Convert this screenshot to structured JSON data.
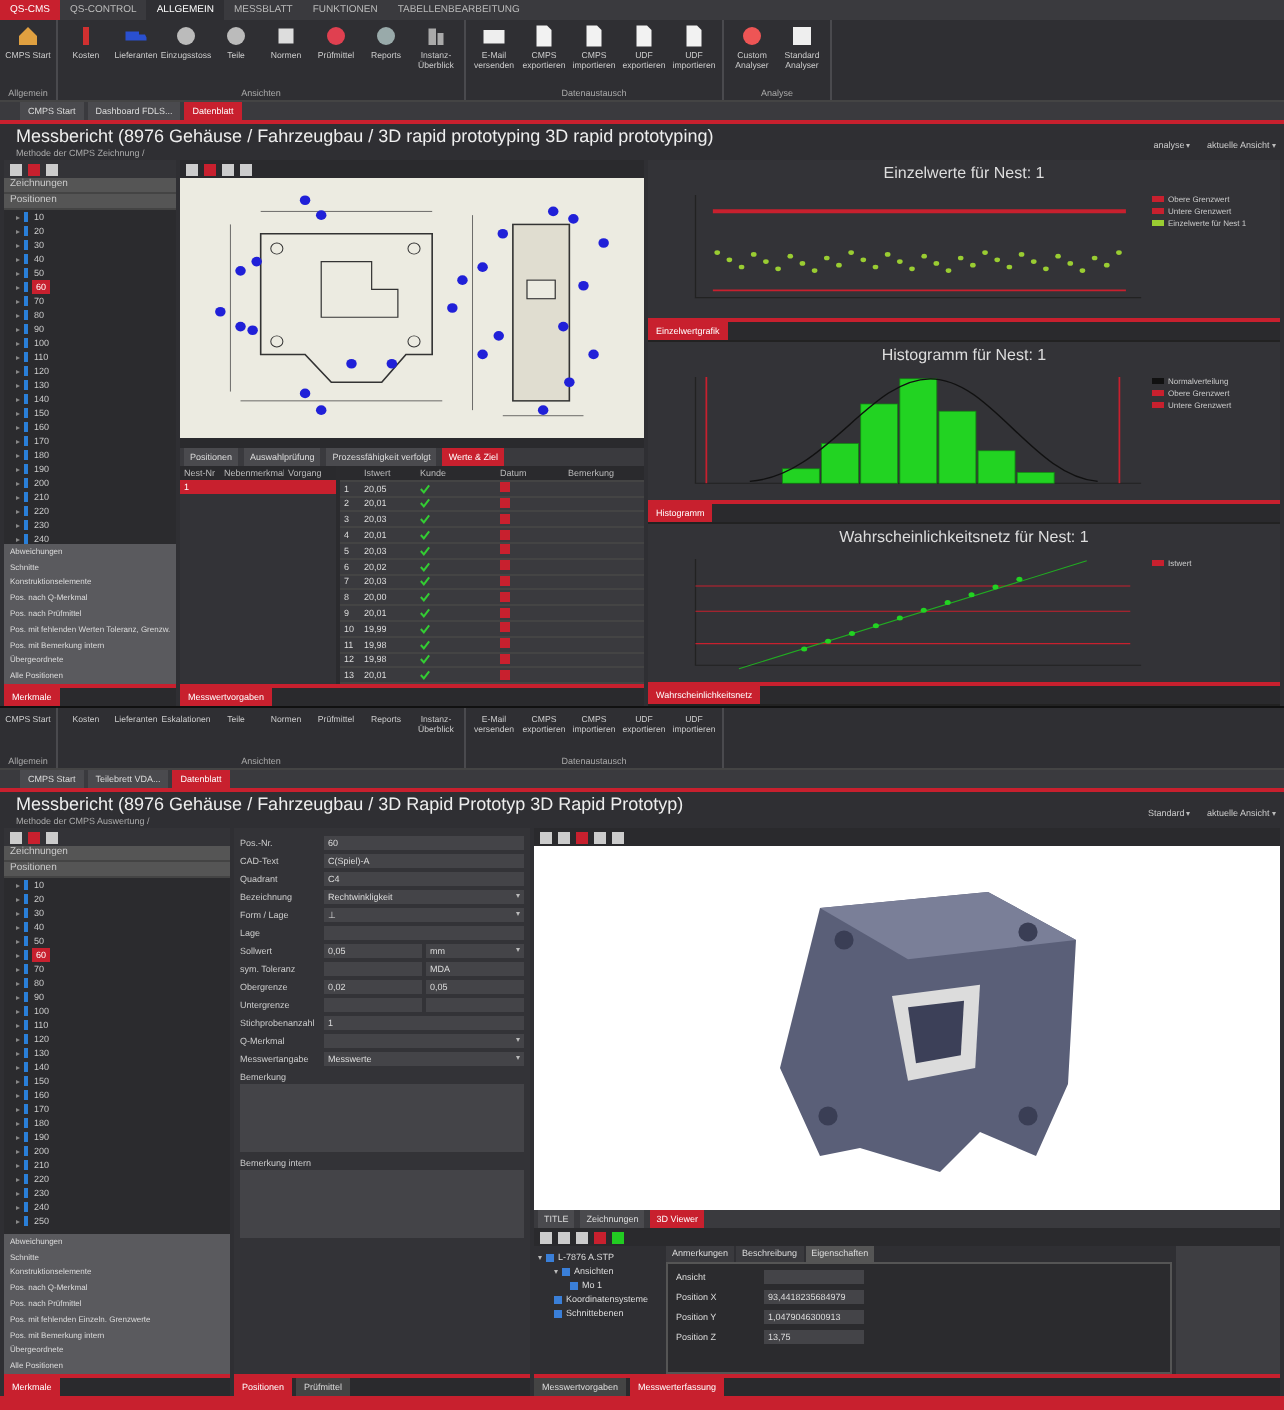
{
  "top": {
    "ribbon_tabs": [
      {
        "label": "QS-CMS",
        "selected": false
      },
      {
        "label": "QS-CONTROL",
        "selected": false
      },
      {
        "label": "ALLGEMEIN",
        "selected": true
      },
      {
        "label": "MESSBLATT",
        "selected": false
      },
      {
        "label": "FUNKTIONEN",
        "selected": false
      },
      {
        "label": "TABELLENBEARBEITUNG",
        "selected": false
      }
    ],
    "ribbon_groups": [
      {
        "label": "Allgemein",
        "buttons": [
          "CMPS Start"
        ]
      },
      {
        "label": "Ansichten",
        "buttons": [
          "Kosten",
          "Lieferanten",
          "Einzugsstoss",
          "Teile",
          "Normen",
          "Prüfmittel",
          "Reports",
          "Instanz-Überblick"
        ]
      },
      {
        "label": "Datenaustausch",
        "buttons": [
          "E-Mail versenden",
          "CMPS exportieren",
          "CMPS importieren",
          "UDF exportieren",
          "UDF importieren"
        ]
      },
      {
        "label": "Analyse",
        "buttons": [
          "Custom Analyser",
          "Standard Analyser"
        ]
      }
    ],
    "doc_tabs": [
      {
        "label": "CMPS Start",
        "selected": false
      },
      {
        "label": "Dashboard FDLS...",
        "selected": false
      },
      {
        "label": "Datenblatt",
        "selected": true
      }
    ],
    "title": "Messbericht (8976 Gehäuse / Fahrzeugbau / 3D rapid prototyping 3D rapid prototyping)",
    "subtitle": "Methode der CMPS Zeichnung /",
    "view_menus": [
      "analyse",
      "aktuelle Ansicht"
    ],
    "tree_headers": [
      "Zeichnungen",
      "Positionen"
    ],
    "tree_items": [
      {
        "label": "10",
        "selected": false
      },
      {
        "label": "20",
        "selected": false
      },
      {
        "label": "30",
        "selected": false
      },
      {
        "label": "40",
        "selected": false
      },
      {
        "label": "50",
        "selected": false
      },
      {
        "label": "60",
        "selected": true
      },
      {
        "label": "70",
        "selected": false
      },
      {
        "label": "80",
        "selected": false
      },
      {
        "label": "90",
        "selected": false
      },
      {
        "label": "100",
        "selected": false
      },
      {
        "label": "110",
        "selected": false
      },
      {
        "label": "120",
        "selected": false
      },
      {
        "label": "130",
        "selected": false
      },
      {
        "label": "140",
        "selected": false
      },
      {
        "label": "150",
        "selected": false
      },
      {
        "label": "160",
        "selected": false
      },
      {
        "label": "170",
        "selected": false
      },
      {
        "label": "180",
        "selected": false
      },
      {
        "label": "190",
        "selected": false
      },
      {
        "label": "200",
        "selected": false
      },
      {
        "label": "210",
        "selected": false
      },
      {
        "label": "220",
        "selected": false
      },
      {
        "label": "230",
        "selected": false
      },
      {
        "label": "240",
        "selected": false
      }
    ],
    "sections": [
      "Abweichungen",
      "Schnitte",
      "Konstruktionselemente",
      "Pos. nach Q-Merkmal",
      "Pos. nach Prüfmittel",
      "Pos. mit fehlenden Werten Toleranz, Grenzw.",
      "Pos. mit Bemerkung intern",
      "Übergeordnete",
      "Alle Positionen"
    ],
    "left_tab": "Merkmale",
    "drawing_tabs": [
      {
        "label": "Positionen",
        "selected": false
      },
      {
        "label": "Auswahlprüfung",
        "selected": false
      },
      {
        "label": "Prozessfähigkeit verfolgt",
        "selected": false
      },
      {
        "label": "Werte & Ziel",
        "selected": true
      }
    ],
    "nest_columns": [
      "Nest-Nr",
      "Nebenmerkmal",
      "Vorgang"
    ],
    "nest_rows": [
      {
        "cells": [
          "1",
          "",
          ""
        ],
        "selected": true
      }
    ],
    "value_columns": [
      "",
      "Istwert",
      "Kunde",
      "Datum",
      "Bemerkung"
    ],
    "value_rows": [
      {
        "index": "1",
        "value": "20,05",
        "passed": true,
        "flagged": true
      },
      {
        "index": "2",
        "value": "20,01",
        "passed": true,
        "flagged": true
      },
      {
        "index": "3",
        "value": "20,03",
        "passed": true,
        "flagged": true
      },
      {
        "index": "4",
        "value": "20,01",
        "passed": true,
        "flagged": true
      },
      {
        "index": "5",
        "value": "20,03",
        "passed": true,
        "flagged": true
      },
      {
        "index": "6",
        "value": "20,02",
        "passed": true,
        "flagged": true
      },
      {
        "index": "7",
        "value": "20,03",
        "passed": true,
        "flagged": true
      },
      {
        "index": "8",
        "value": "20,00",
        "passed": true,
        "flagged": true
      },
      {
        "index": "9",
        "value": "20,01",
        "passed": true,
        "flagged": true
      },
      {
        "index": "10",
        "value": "19,99",
        "passed": true,
        "flagged": true
      },
      {
        "index": "11",
        "value": "19,98",
        "passed": true,
        "flagged": true
      },
      {
        "index": "12",
        "value": "19,98",
        "passed": true,
        "flagged": true
      },
      {
        "index": "13",
        "value": "20,01",
        "passed": true,
        "flagged": true
      }
    ],
    "table_tab": "Messwertvorgaben",
    "charts": [
      {
        "kind": "scatter",
        "title": "Einzelwerte für Nest: 1",
        "tab": "Einzelwertgrafik",
        "legend": [
          {
            "label": "Obere Grenzwert",
            "color": "#c8202e"
          },
          {
            "label": "Untere Grenzwert",
            "color": "#c8202e"
          },
          {
            "label": "Einzelwerte für Nest 1",
            "color": "#9acd32"
          }
        ]
      },
      {
        "kind": "histogram",
        "title": "Histogramm für Nest: 1",
        "tab": "Histogramm",
        "legend": [
          {
            "label": "Normalverteilung",
            "color": "#111111"
          },
          {
            "label": "Obere Grenzwert",
            "color": "#c8202e"
          },
          {
            "label": "Untere Grenzwert",
            "color": "#c8202e"
          }
        ]
      },
      {
        "kind": "probability",
        "title": "Wahrscheinlichkeitsnetz für Nest: 1",
        "tab": "Wahrscheinlichkeitsnetz",
        "legend": [
          {
            "label": "Istwert",
            "color": "#c8202e"
          }
        ]
      }
    ]
  },
  "bottom": {
    "ribbon_groups": [
      {
        "label": "Allgemein",
        "buttons": [
          "CMPS Start"
        ]
      },
      {
        "label": "Ansichten",
        "buttons": [
          "Kosten",
          "Lieferanten",
          "Eskalationen",
          "Teile",
          "Normen",
          "Prüfmittel",
          "Reports",
          "Instanz-Überblick"
        ]
      },
      {
        "label": "Datenaustausch",
        "buttons": [
          "E-Mail versenden",
          "CMPS exportieren",
          "CMPS importieren",
          "UDF exportieren",
          "UDF importieren"
        ]
      }
    ],
    "doc_tabs": [
      {
        "label": "CMPS Start",
        "selected": false
      },
      {
        "label": "Teilebrett VDA...",
        "selected": false
      },
      {
        "label": "Datenblatt",
        "selected": true
      }
    ],
    "title": "Messbericht (8976 Gehäuse / Fahrzeugbau / 3D Rapid Prototyp 3D Rapid Prototyp)",
    "subtitle": "Methode der CMPS Auswertung /",
    "view_menus": [
      "Standard",
      "aktuelle Ansicht"
    ],
    "tree_headers": [
      "Zeichnungen",
      "Positionen"
    ],
    "tree_items": [
      {
        "label": "10",
        "selected": false
      },
      {
        "label": "20",
        "selected": false
      },
      {
        "label": "30",
        "selected": false
      },
      {
        "label": "40",
        "selected": false
      },
      {
        "label": "50",
        "selected": false
      },
      {
        "label": "60",
        "selected": true
      },
      {
        "label": "70",
        "selected": false
      },
      {
        "label": "80",
        "selected": false
      },
      {
        "label": "90",
        "selected": false
      },
      {
        "label": "100",
        "selected": false
      },
      {
        "label": "110",
        "selected": false
      },
      {
        "label": "120",
        "selected": false
      },
      {
        "label": "130",
        "selected": false
      },
      {
        "label": "140",
        "selected": false
      },
      {
        "label": "150",
        "selected": false
      },
      {
        "label": "160",
        "selected": false
      },
      {
        "label": "170",
        "selected": false
      },
      {
        "label": "180",
        "selected": false
      },
      {
        "label": "190",
        "selected": false
      },
      {
        "label": "200",
        "selected": false
      },
      {
        "label": "210",
        "selected": false
      },
      {
        "label": "220",
        "selected": false
      },
      {
        "label": "230",
        "selected": false
      },
      {
        "label": "240",
        "selected": false
      },
      {
        "label": "250",
        "selected": false
      }
    ],
    "sections": [
      "Abweichungen",
      "Schnitte",
      "Konstruktionselemente",
      "Pos. nach Q-Merkmal",
      "Pos. nach Prüfmittel",
      "Pos. mit fehlenden Einzeln. Grenzwerte",
      "Pos. mit Bemerkung intern",
      "Übergeordnete",
      "Alle Positionen"
    ],
    "left_tab": "Merkmale",
    "form": [
      {
        "kind": "text",
        "label": "Pos.-Nr.",
        "value": "60"
      },
      {
        "kind": "text",
        "label": "CAD-Text",
        "value": "C(Spiel)-A"
      },
      {
        "kind": "text",
        "label": "Quadrant",
        "value": "C4"
      },
      {
        "kind": "select",
        "label": "Bezeichnung",
        "value": "Rechtwinkligkeit"
      },
      {
        "kind": "select",
        "label": "Form / Lage",
        "value": "⊥"
      },
      {
        "kind": "text",
        "label": "Lage"
      },
      {
        "kind": "unit",
        "label": "Sollwert",
        "value": "0,05",
        "unit": "mm"
      },
      {
        "kind": "pair",
        "label": "sym. Toleranz",
        "second": "MDA"
      },
      {
        "kind": "pair",
        "label": "Obergrenze",
        "value": "0,02",
        "second": "0,05"
      },
      {
        "kind": "pair",
        "label": "Untergrenze"
      },
      {
        "kind": "text",
        "label": "Stichprobenanzahl",
        "value": "1"
      },
      {
        "kind": "select",
        "label": "Q-Merkmal"
      },
      {
        "kind": "select",
        "label": "Messwertangabe",
        "value": "Messwerte"
      },
      {
        "kind": "area",
        "label": "Bemerkung"
      },
      {
        "kind": "area",
        "label": "Bemerkung intern"
      }
    ],
    "form_tabs": [
      {
        "label": "Positionen",
        "selected": true
      },
      {
        "label": "Prüfmittel",
        "selected": false
      }
    ],
    "viewer_tabs": [
      {
        "label": "TITLE",
        "selected": false
      },
      {
        "label": "Zeichnungen",
        "selected": false
      },
      {
        "label": "3D Viewer",
        "selected": true
      }
    ],
    "model_tree": [
      {
        "label": "L-7876 A.STP",
        "children": [
          {
            "label": "Ansichten",
            "children": [
              {
                "label": "Mo 1"
              }
            ]
          },
          {
            "label": "Koordinatensysteme"
          },
          {
            "label": "Schnittebenen"
          }
        ]
      }
    ],
    "property_tabs": [
      {
        "label": "Anmerkungen",
        "selected": false
      },
      {
        "label": "Beschreibung",
        "selected": false
      },
      {
        "label": "Eigenschaften",
        "selected": true
      }
    ],
    "properties": [
      {
        "label": "Ansicht"
      },
      {
        "label": "Position X",
        "value": "93,4418235684979"
      },
      {
        "label": "Position Y",
        "value": "1,0479046300913"
      },
      {
        "label": "Position Z",
        "value": "13,75"
      }
    ],
    "panel_tabs": [
      {
        "label": "Messwertvorgaben",
        "selected": false
      },
      {
        "label": "Messwerterfassung",
        "selected": true
      }
    ]
  }
}
